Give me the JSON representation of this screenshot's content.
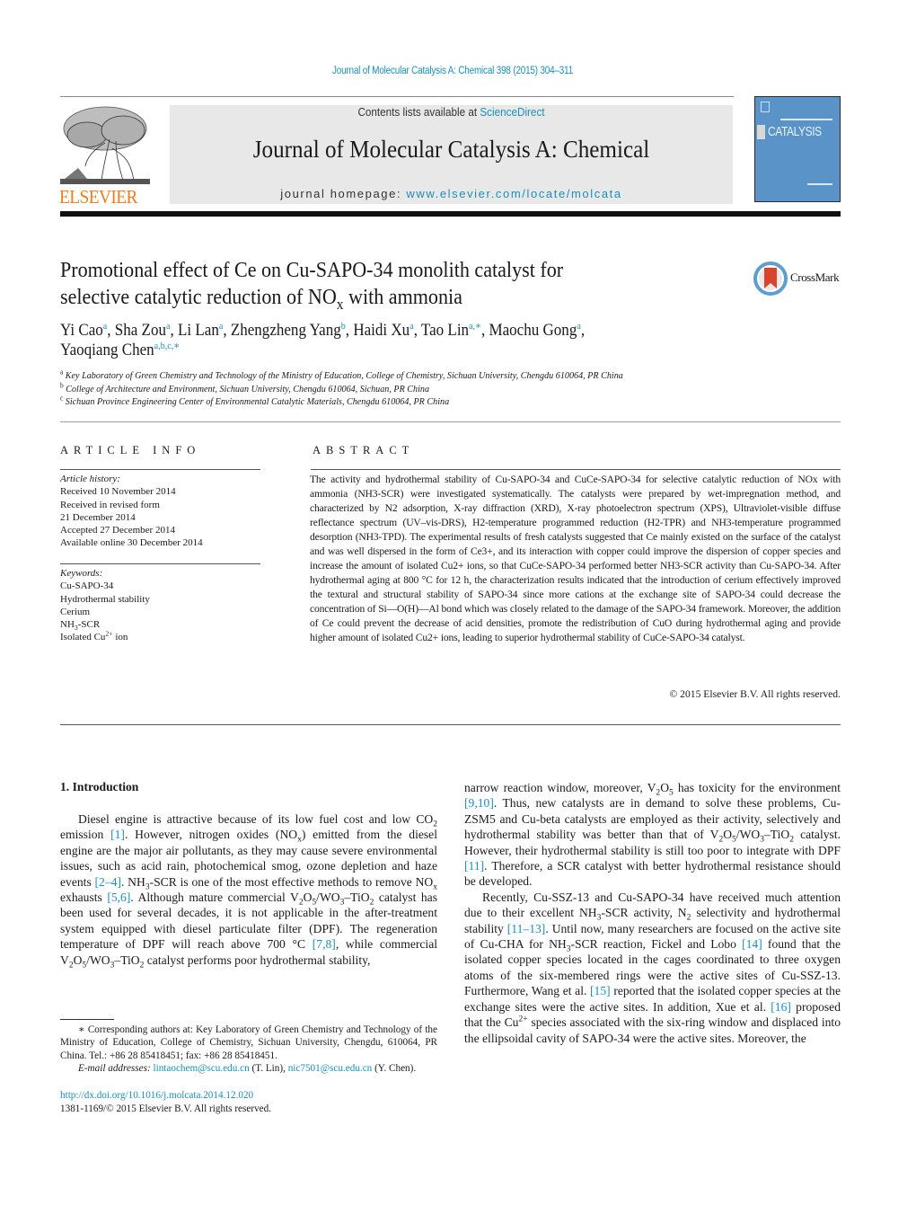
{
  "header": {
    "running_head": "Journal of Molecular Catalysis A: Chemical 398 (2015) 304–311",
    "publisher_logo_text": "ELSEVIER",
    "contents_prefix": "Contents lists available at ",
    "contents_link": "ScienceDirect",
    "journal_title": "Journal of Molecular Catalysis A: Chemical",
    "homepage_prefix": "journal homepage: ",
    "homepage_link": "www.elsevier.com/locate/molcata",
    "cover_text": "CATALYSIS",
    "colors": {
      "link": "#1a8fb8",
      "elsevier_orange": "#f07c1e",
      "cover_blue": "#5a93c7",
      "crossmark_red": "#d9452b"
    }
  },
  "article": {
    "title_line1": "Promotional effect of Ce on Cu-SAPO-34 monolith catalyst for",
    "title_line2_pre": "selective catalytic reduction of NO",
    "title_line2_sub": "x",
    "title_line2_post": " with ammonia",
    "crossmark_label": "CrossMark",
    "authors": [
      {
        "name": "Yi Cao",
        "aff": "a"
      },
      {
        "name": "Sha Zou",
        "aff": "a"
      },
      {
        "name": "Li Lan",
        "aff": "a"
      },
      {
        "name": "Zhengzheng Yang",
        "aff": "b"
      },
      {
        "name": "Haidi Xu",
        "aff": "a"
      },
      {
        "name": "Tao Lin",
        "aff": "a,∗"
      },
      {
        "name": "Maochu Gong",
        "aff": "a"
      },
      {
        "name": "Yaoqiang Chen",
        "aff": "a,b,c,∗"
      }
    ],
    "affiliations": [
      {
        "key": "a",
        "text": "Key Laboratory of Green Chemistry and Technology of the Ministry of Education, College of Chemistry, Sichuan University, Chengdu 610064, PR China"
      },
      {
        "key": "b",
        "text": "College of Architecture and Environment, Sichuan University, Chengdu 610064, Sichuan, PR China"
      },
      {
        "key": "c",
        "text": "Sichuan Province Engineering Center of Environmental Catalytic Materials, Chengdu 610064, PR China"
      }
    ]
  },
  "article_info": {
    "heading": "ARTICLE INFO",
    "history_label": "Article history:",
    "history": [
      "Received 10 November 2014",
      "Received in revised form",
      "21 December 2014",
      "Accepted 27 December 2014",
      "Available online 30 December 2014"
    ],
    "keywords_label": "Keywords:",
    "keywords": [
      "Cu-SAPO-34",
      "Hydrothermal stability",
      "Cerium",
      "NH3-SCR",
      "Isolated Cu2+ ion"
    ]
  },
  "abstract": {
    "heading": "ABSTRACT",
    "text": "The activity and hydrothermal stability of Cu-SAPO-34 and CuCe-SAPO-34 for selective catalytic reduction of NOx with ammonia (NH3-SCR) were investigated systematically. The catalysts were prepared by wet-impregnation method, and characterized by N2 adsorption, X-ray diffraction (XRD), X-ray photoelectron spectrum (XPS), Ultraviolet-visible diffuse reflectance spectrum (UV–vis-DRS), H2-temperature programmed reduction (H2-TPR) and NH3-temperature programmed desorption (NH3-TPD). The experimental results of fresh catalysts suggested that Ce mainly existed on the surface of the catalyst and was well dispersed in the form of Ce3+, and its interaction with copper could improve the dispersion of copper species and increase the amount of isolated Cu2+ ions, so that CuCe-SAPO-34 performed better NH3-SCR activity than Cu-SAPO-34. After hydrothermal aging at 800 °C for 12 h, the characterization results indicated that the introduction of cerium effectively improved the textural and structural stability of SAPO-34 since more cations at the exchange site of SAPO-34 could decrease the concentration of Si—O(H)—Al bond which was closely related to the damage of the SAPO-34 framework. Moreover, the addition of Ce could prevent the decrease of acid densities, promote the redistribution of CuO during hydrothermal aging and provide higher amount of isolated Cu2+ ions, leading to superior hydrothermal stability of CuCe-SAPO-34 catalyst.",
    "copyright": "© 2015 Elsevier B.V. All rights reserved."
  },
  "body": {
    "section_heading": "1.  Introduction",
    "refs": [
      "[1]",
      "[2–4]",
      "[5,6]",
      "[7,8]",
      "[9,10]",
      "[11]",
      "[11–13]",
      "[14]",
      "[15]",
      "[16]"
    ]
  },
  "footnotes": {
    "corresponding": "∗  Corresponding authors at: Key Laboratory of Green Chemistry and Technology of the Ministry of Education, College of Chemistry, Sichuan University, Chengdu, 610064, PR China. Tel.: +86 28 85418451; fax: +86 28 85418451.",
    "email_label": "E-mail addresses:",
    "email1": "lintaochem@scu.edu.cn",
    "email1_owner": " (T. Lin), ",
    "email2": "nic7501@scu.edu.cn",
    "email2_owner": " (Y. Chen).",
    "doi": "http://dx.doi.org/10.1016/j.molcata.2014.12.020",
    "issn_line": "1381-1169/© 2015 Elsevier B.V. All rights reserved."
  }
}
